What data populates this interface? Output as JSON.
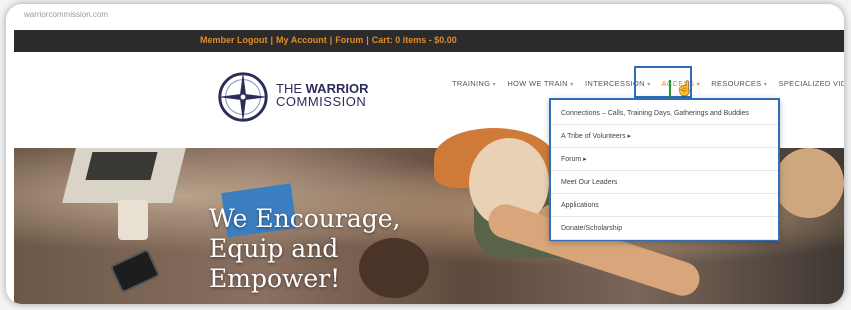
{
  "browser": {
    "url": "warriorcommission.com"
  },
  "topbar": {
    "member_logout": "Member Logout",
    "my_account": "My Account",
    "forum": "Forum",
    "cart": "Cart: 0 items - $0.00",
    "separator": "|"
  },
  "brand": {
    "line1_pre": "THE ",
    "line1_bold": "WARRIOR",
    "line2": "COMMISSION"
  },
  "nav": {
    "items": [
      {
        "label": "TRAINING",
        "caret": "▾"
      },
      {
        "label": "HOW WE TRAIN",
        "caret": "▾"
      },
      {
        "label": "INTERCESSION",
        "caret": "▾"
      },
      {
        "label": "ACCESS",
        "caret": "▾"
      },
      {
        "label": "RESOURCES",
        "caret": "▾"
      },
      {
        "label": "SPECIALIZED VIDEOS",
        "caret": ""
      }
    ]
  },
  "dropdown": {
    "items": [
      "Connections – Calls, Training Days, Gatherings and Buddies",
      "A Tribe of Volunteers ▸",
      "Forum ▸",
      "Meet Our Leaders",
      "Applications",
      "Donate/Scholarship"
    ]
  },
  "hero": {
    "line1": "We Encourage,",
    "line2": "Equip and",
    "line3": "Empower!"
  },
  "colors": {
    "accent": "#e08b2c",
    "highlight": "#2f6db5",
    "arrow": "#1e9a3a",
    "brand": "#2d2d5a"
  }
}
